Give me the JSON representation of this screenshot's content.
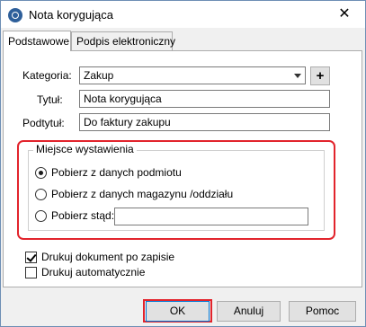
{
  "window": {
    "title": "Nota korygująca",
    "close_symbol": "✕"
  },
  "tabs": [
    {
      "label": "Podstawowe",
      "active": true
    },
    {
      "label": "Podpis elektroniczny",
      "active": false
    }
  ],
  "form": {
    "kategoria_label": "Kategoria:",
    "kategoria_value": "Zakup",
    "add_symbol": "+",
    "tytul_label": "Tytuł:",
    "tytul_value": "Nota korygująca",
    "podtytul_label": "Podtytuł:",
    "podtytul_value": "Do faktury zakupu"
  },
  "miejsce": {
    "legend": "Miejsce wystawienia",
    "options": [
      {
        "label": "Pobierz z danych podmiotu",
        "checked": true
      },
      {
        "label": "Pobierz z danych magazynu /oddziału",
        "checked": false
      },
      {
        "label": "Pobierz stąd:",
        "checked": false
      }
    ],
    "stad_value": ""
  },
  "checkboxes": [
    {
      "label": "Drukuj dokument po zapisie",
      "checked": true
    },
    {
      "label": "Drukuj automatycznie",
      "checked": false
    }
  ],
  "buttons": {
    "ok": "OK",
    "cancel": "Anuluj",
    "help": "Pomoc"
  },
  "colors": {
    "highlight": "#e2242c",
    "focus": "#0078d7"
  }
}
